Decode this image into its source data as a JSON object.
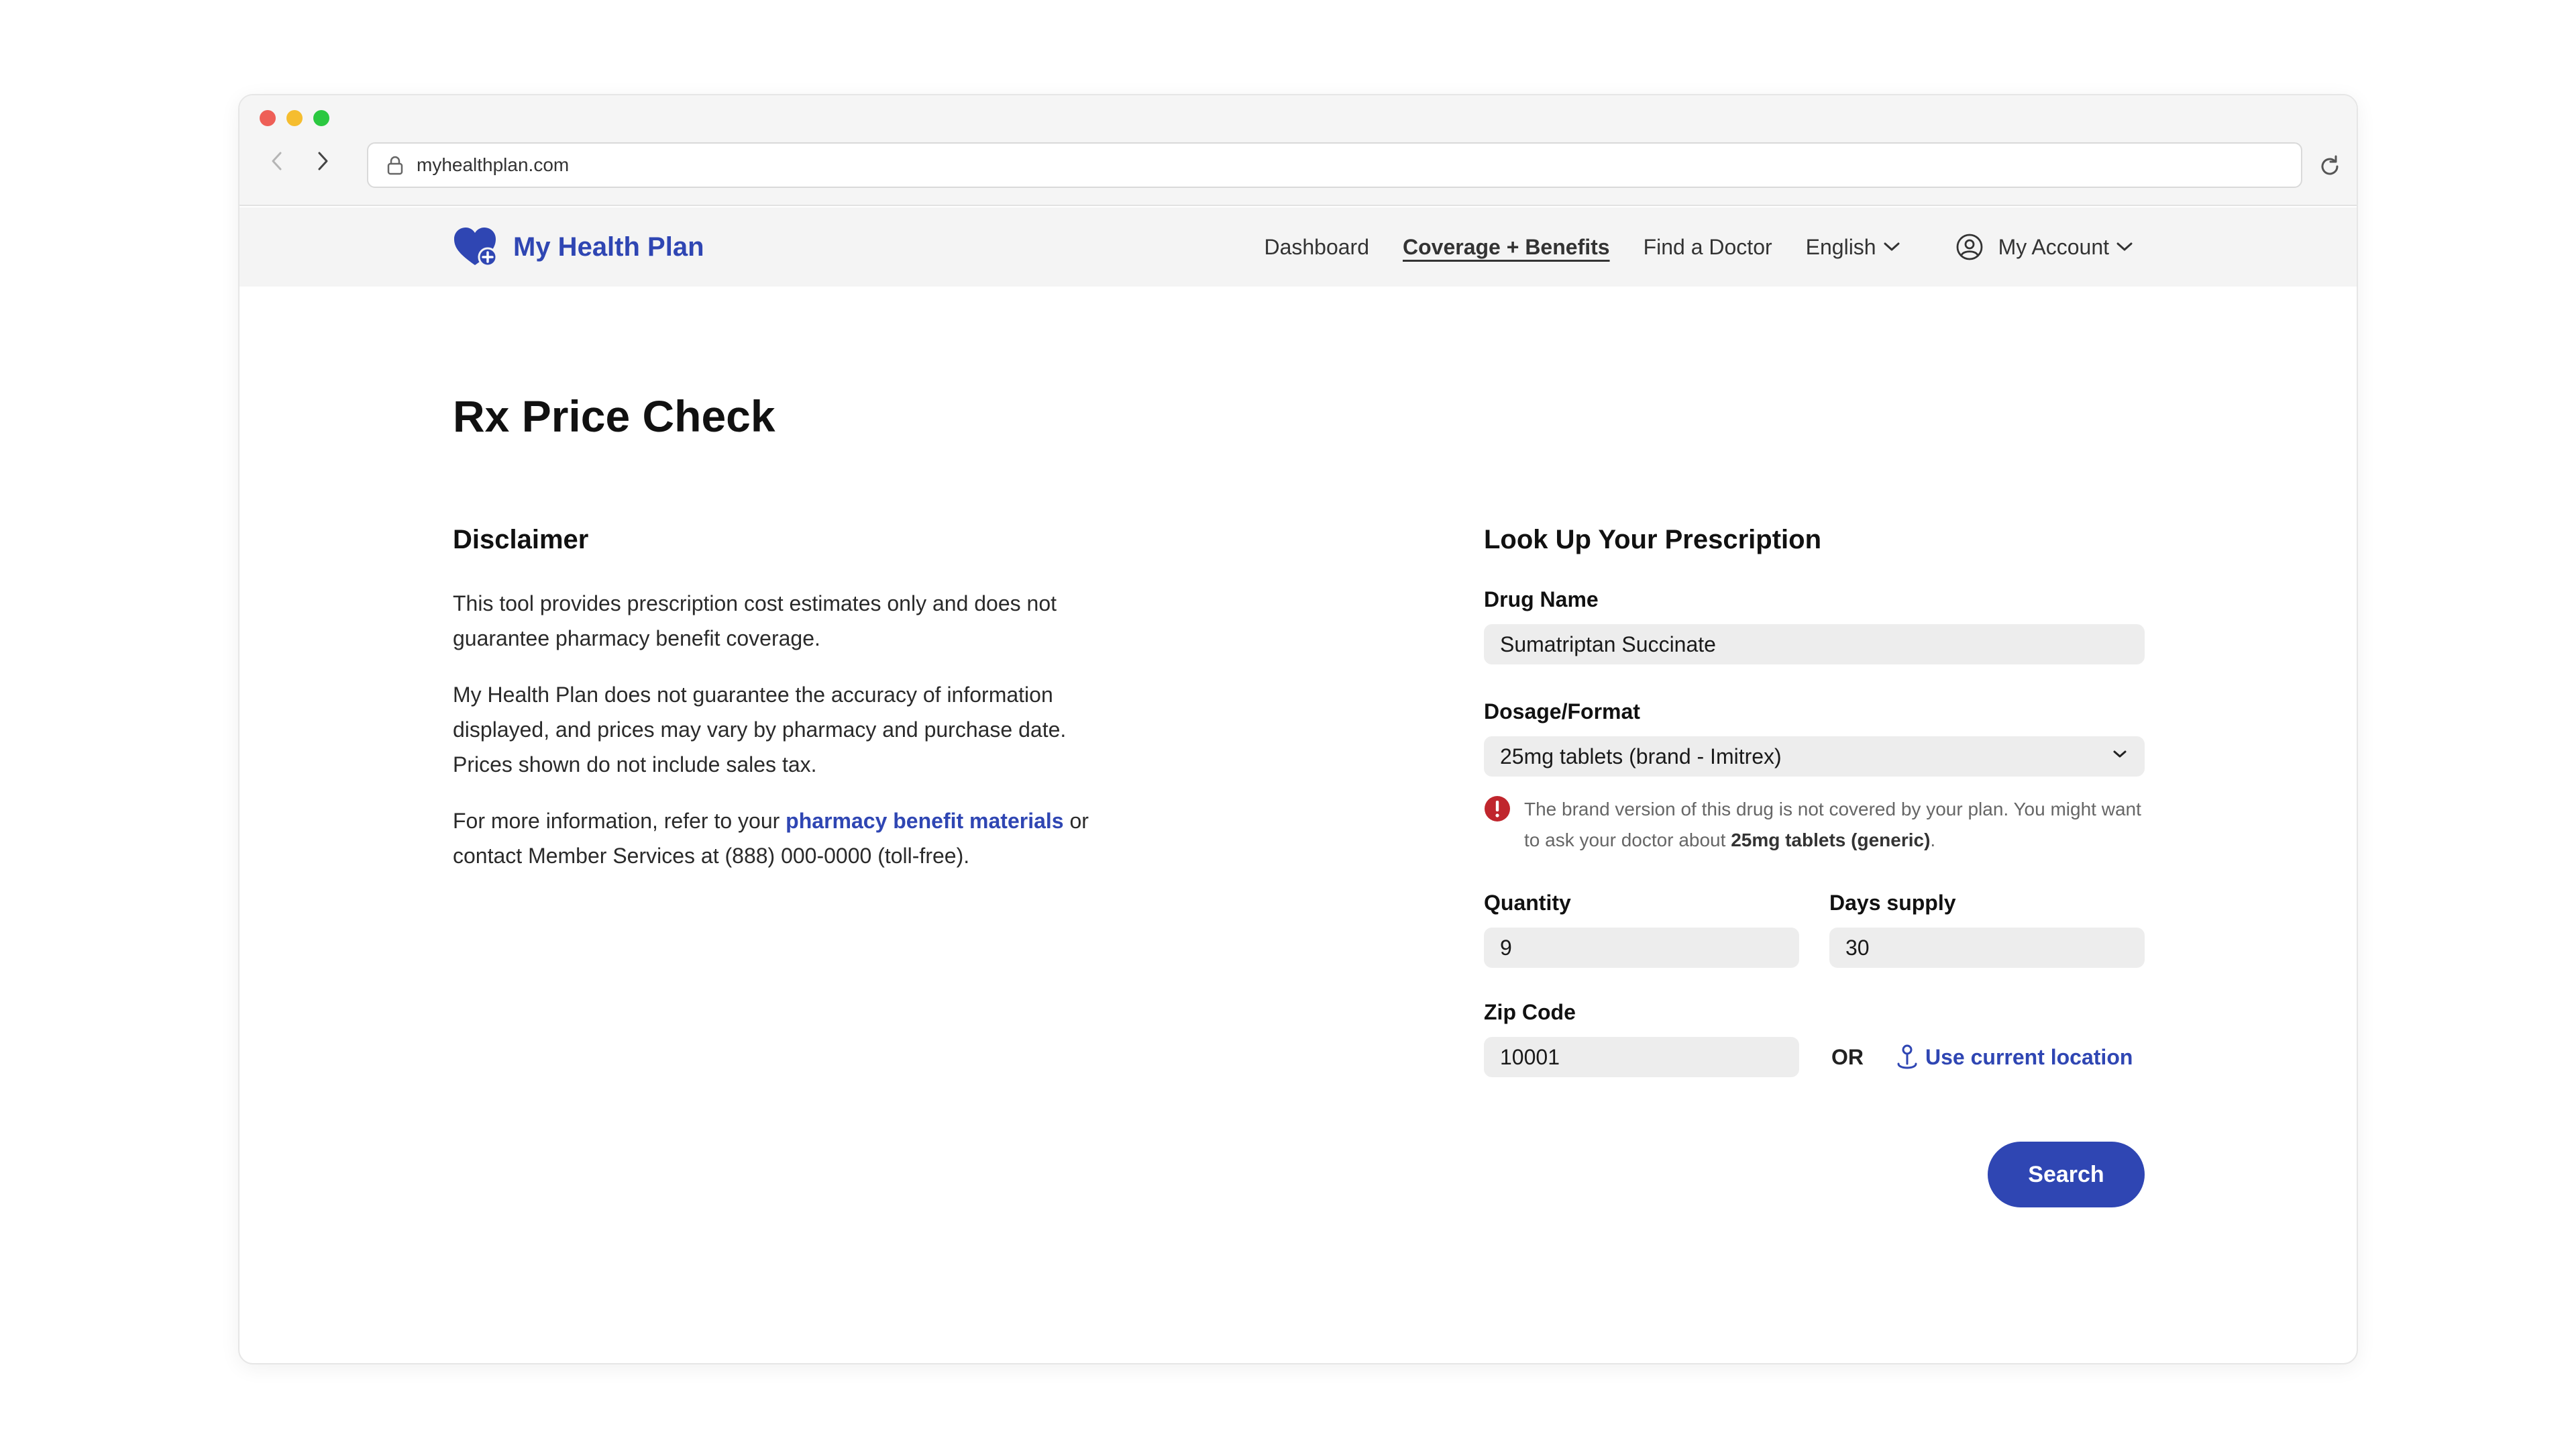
{
  "browser": {
    "url": "myhealthplan.com"
  },
  "header": {
    "brand_name": "My Health Plan",
    "nav": {
      "dashboard": "Dashboard",
      "coverage": "Coverage + Benefits",
      "find_doctor": "Find a Doctor",
      "language": "English",
      "account": "My Account"
    }
  },
  "page": {
    "title": "Rx Price Check"
  },
  "disclaimer": {
    "heading": "Disclaimer",
    "p1": "This tool provides prescription cost estimates only and does not guarantee pharmacy benefit coverage.",
    "p2": "My Health Plan does not guarantee the accuracy of information displayed, and prices may vary by pharmacy and purchase date. Prices shown do not include sales tax.",
    "p3_before": "For more information, refer to your ",
    "p3_link": "pharmacy benefit materials",
    "p3_after": " or contact Member Services at (888) 000-0000 (toll-free)."
  },
  "form": {
    "heading": "Look Up Your Prescription",
    "drug_name_label": "Drug Name",
    "drug_name_value": "Sumatriptan Succinate",
    "dosage_label": "Dosage/Format",
    "dosage_value": "25mg tablets (brand - Imitrex)",
    "warning_text": "The brand version of this drug is not covered by your plan. You might want to ask your doctor about ",
    "warning_bold": "25mg tablets (generic)",
    "warning_end": ".",
    "quantity_label": "Quantity",
    "quantity_value": "9",
    "days_label": "Days supply",
    "days_value": "30",
    "zip_label": "Zip Code",
    "zip_value": "10001",
    "or_text": "OR",
    "location_link": "Use current location",
    "search_button": "Search"
  },
  "colors": {
    "brand": "#2f46b3",
    "error": "#c0262d"
  }
}
